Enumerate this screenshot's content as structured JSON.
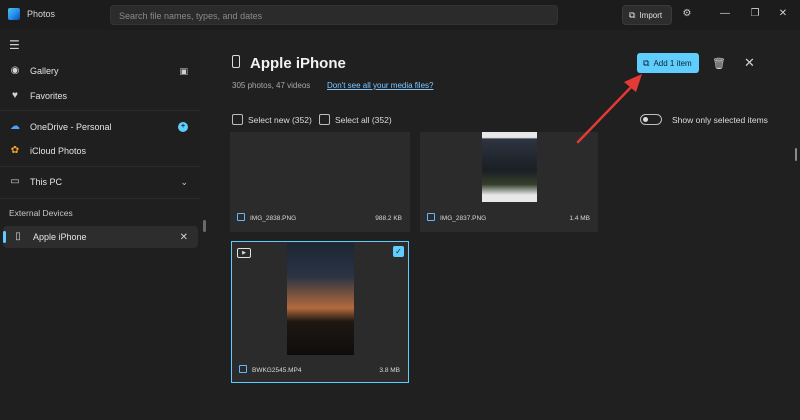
{
  "app": {
    "title": "Photos"
  },
  "search": {
    "placeholder": "Search file names, types, and dates"
  },
  "titlebar": {
    "import_label": "Import"
  },
  "sidebar": {
    "items": [
      {
        "label": "Gallery"
      },
      {
        "label": "Favorites"
      },
      {
        "label": "OneDrive - Personal"
      },
      {
        "label": "iCloud Photos"
      },
      {
        "label": "This PC"
      }
    ],
    "section_label": "External Devices",
    "device_item": {
      "label": "Apple iPhone"
    }
  },
  "main": {
    "title": "Apple iPhone",
    "counts": "305 photos, 47 videos",
    "media_link": "Don't see all your media files?",
    "add_label": "Add 1 item",
    "select_new": "Select new (352)",
    "select_all": "Select all (352)",
    "toggle_label": "Show only selected items"
  },
  "tiles": [
    {
      "name": "IMG_2838.PNG",
      "size": "988.2 KB"
    },
    {
      "name": "IMG_2837.PNG",
      "size": "1.4 MB"
    },
    {
      "name": "BWKG2545.MP4",
      "size": "3.8 MB"
    }
  ],
  "colors": {
    "accent": "#60cdff",
    "annotation_arrow": "#e53935"
  }
}
